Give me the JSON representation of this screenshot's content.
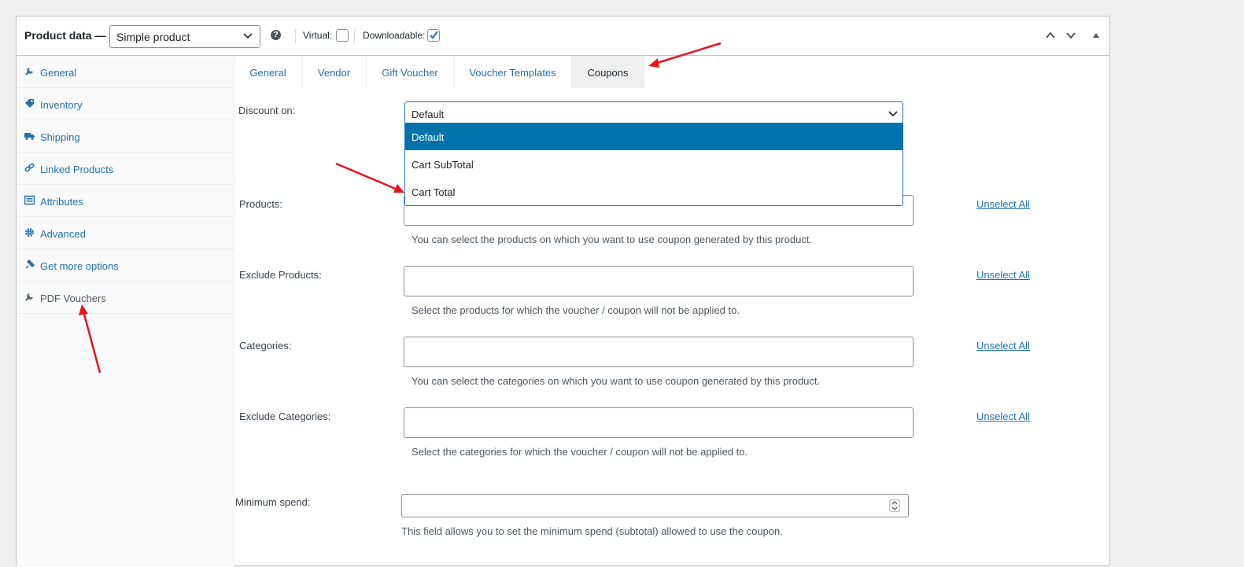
{
  "header": {
    "title": "Product data —",
    "product_type": "Simple product",
    "help_glyph": "?",
    "virtual_label": "Virtual:",
    "virtual_checked": false,
    "downloadable_label": "Downloadable:",
    "downloadable_checked": true
  },
  "sidebar": {
    "items": [
      {
        "label": "General",
        "icon": "wrench-icon"
      },
      {
        "label": "Inventory",
        "icon": "tag-icon"
      },
      {
        "label": "Shipping",
        "icon": "truck-icon"
      },
      {
        "label": "Linked Products",
        "icon": "link-icon"
      },
      {
        "label": "Attributes",
        "icon": "list-icon"
      },
      {
        "label": "Advanced",
        "icon": "gear-icon"
      },
      {
        "label": "Get more options",
        "icon": "plugin-icon"
      },
      {
        "label": "PDF Vouchers",
        "icon": "wrench-icon"
      }
    ]
  },
  "tabs": [
    {
      "label": "General"
    },
    {
      "label": "Vendor"
    },
    {
      "label": "Gift Voucher"
    },
    {
      "label": "Voucher Templates"
    },
    {
      "label": "Coupons",
      "active": true
    }
  ],
  "form": {
    "discount_label": "Discount on:",
    "discount_value": "Default",
    "discount_options": [
      "Default",
      "Cart SubTotal",
      "Cart Total"
    ],
    "products_label": "Products:",
    "products_desc": "You can select the products on which you want to use coupon generated by this product.",
    "exclude_products_label": "Exclude Products:",
    "exclude_products_desc": "Select the products for which the voucher / coupon will not be applied to.",
    "categories_label": "Categories:",
    "categories_desc": "You can select the categories on which you want to use coupon generated by this product.",
    "exclude_categories_label": "Exclude Categories:",
    "exclude_categories_desc": "Select the categories for which the voucher / coupon will not be applied to.",
    "unselect_all": "Unselect All",
    "min_spend_label": "Minimum spend:",
    "min_spend_desc": "This field allows you to set the minimum spend (subtotal) allowed to use the coupon."
  },
  "colors": {
    "link": "#2271b1",
    "selected_option_bg": "#0073aa",
    "annotation_arrow": "#e8141e"
  }
}
